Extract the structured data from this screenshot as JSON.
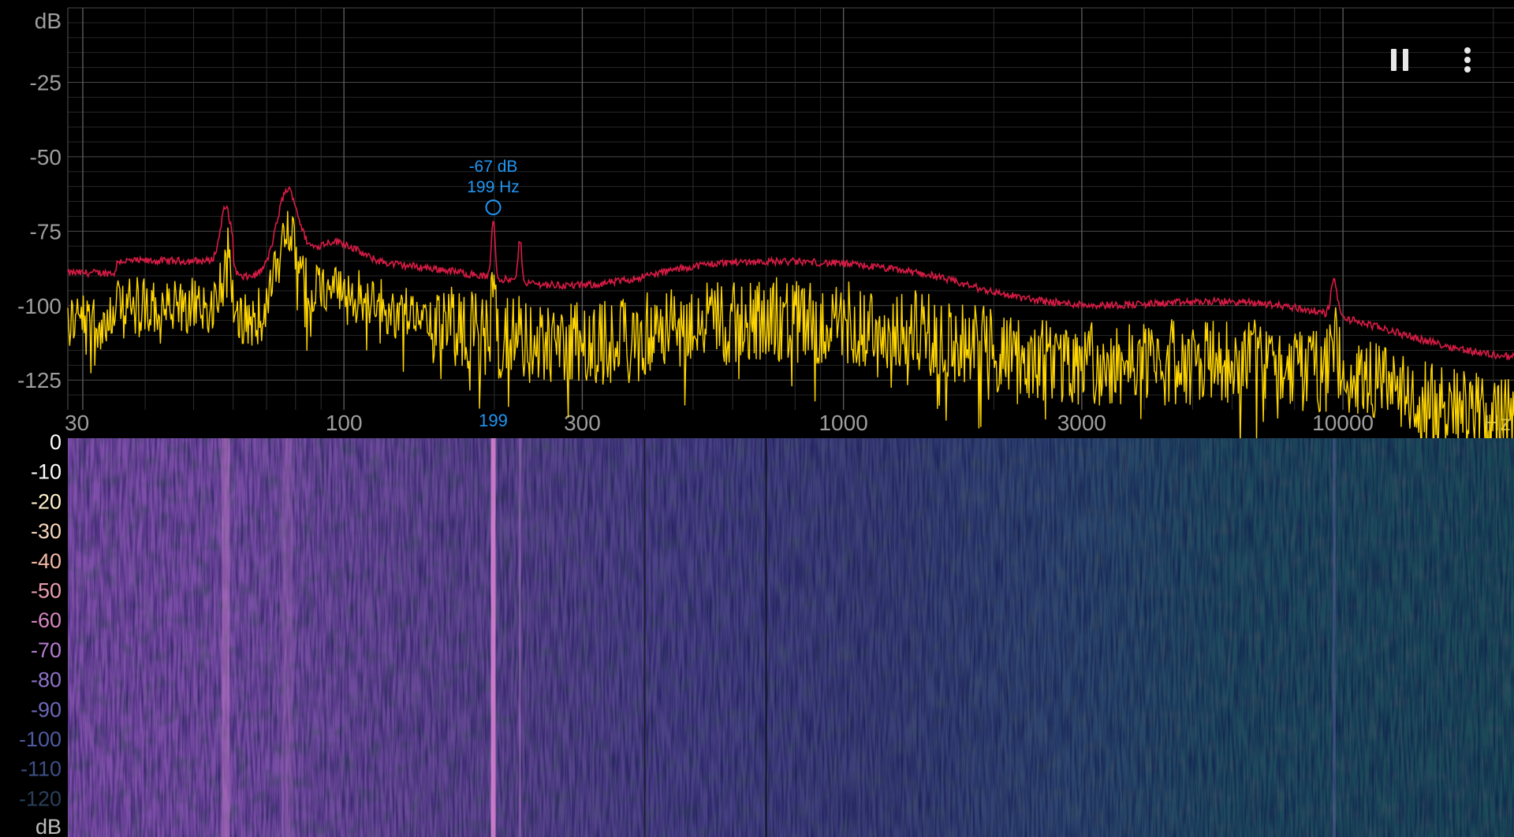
{
  "spectrum": {
    "y_unit_top": "dB",
    "y_ticks": [
      "-25",
      "-50",
      "-75",
      "-100",
      "-125"
    ],
    "y_tick_values": [
      -25,
      -50,
      -75,
      -100,
      -125
    ],
    "x_ticks": [
      "30",
      "100",
      "300",
      "1000",
      "3000",
      "10000"
    ],
    "x_tick_values": [
      30,
      100,
      300,
      1000,
      3000,
      10000
    ],
    "x_unit": "Hz",
    "x_range": [
      28,
      22000
    ],
    "y_range": [
      0,
      -135
    ],
    "peak_marker": {
      "db_label": "-67 dB",
      "hz_label": "199 Hz",
      "freq_label": "199",
      "freq": 199,
      "db": -67
    },
    "colors": {
      "peak_hold": "#d81b45",
      "live": "#ffd600",
      "marker": "#2196f3",
      "grid": "#3a3a3a"
    }
  },
  "spectrogram": {
    "db_ticks": [
      "0",
      "-10",
      "-20",
      "-30",
      "-40",
      "-50",
      "-60",
      "-70",
      "-80",
      "-90",
      "-100",
      "-110",
      "-120"
    ],
    "db_tick_colors": [
      "#ffffff",
      "#ffffff",
      "#fff2cc",
      "#f8d7bd",
      "#f4b9a8",
      "#eb9eb3",
      "#d786c0",
      "#b57cd0",
      "#8d72c8",
      "#6b68b8",
      "#4e5ba0",
      "#3d4f86",
      "#2a3f5a"
    ],
    "unit": "dB"
  },
  "toolbar": {
    "pause_icon": "pause-icon",
    "menu_icon": "more-vert-icon"
  }
}
